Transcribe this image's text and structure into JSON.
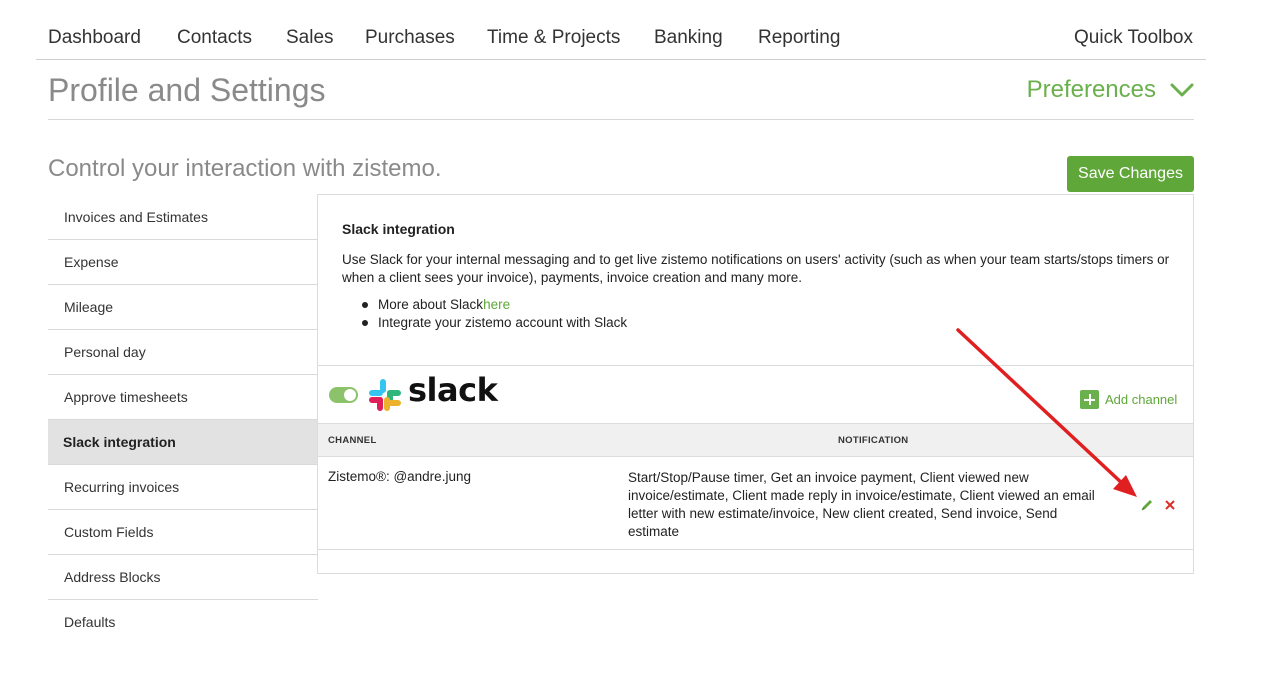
{
  "nav": {
    "items": [
      "Dashboard",
      "Contacts",
      "Sales",
      "Purchases",
      "Time & Projects",
      "Banking",
      "Reporting"
    ],
    "toolbox": "Quick Toolbox"
  },
  "header": {
    "title": "Profile and Settings",
    "preferences": "Preferences"
  },
  "subtitle": "Control your interaction with zistemo.",
  "save_label": "Save Changes",
  "sidebar": {
    "items": [
      {
        "label": "Invoices and Estimates"
      },
      {
        "label": "Expense"
      },
      {
        "label": "Mileage"
      },
      {
        "label": "Personal day"
      },
      {
        "label": "Approve timesheets"
      },
      {
        "label": "Slack integration",
        "active": true
      },
      {
        "label": "Recurring invoices"
      },
      {
        "label": "Custom Fields"
      },
      {
        "label": "Address Blocks"
      },
      {
        "label": "Defaults"
      }
    ]
  },
  "panel": {
    "title": "Slack integration",
    "description": "Use Slack for your internal messaging and to get live zistemo notifications on users' activity (such as when your team starts/stops timers or when a client sees your invoice), payments, invoice creation and many more.",
    "bullet1_text": "More about Slack ",
    "bullet1_link": "here",
    "bullet2_text": "Integrate your zistemo account with Slack",
    "slack_word": "slack",
    "toggle_on": true,
    "add_channel": "Add channel",
    "table": {
      "headers": [
        "CHANNEL",
        "NOTIFICATION"
      ],
      "rows": [
        {
          "channel": "Zistemo®: @andre.jung",
          "notification": "Start/Stop/Pause timer, Get an invoice payment, Client viewed new invoice/estimate, Client made reply in invoice/estimate, Client viewed an email letter with new estimate/invoice, New client created, Send invoice, Send estimate"
        }
      ]
    }
  },
  "colors": {
    "accent": "#5fa739",
    "link": "#5fa739",
    "annotation_arrow": "#e02020",
    "delete": "#d9302b"
  },
  "icons": {
    "preferences": "chevron-down-icon",
    "slack": "slack-logo-icon",
    "add": "plus-icon",
    "edit": "pencil-icon",
    "delete": "close-icon"
  }
}
